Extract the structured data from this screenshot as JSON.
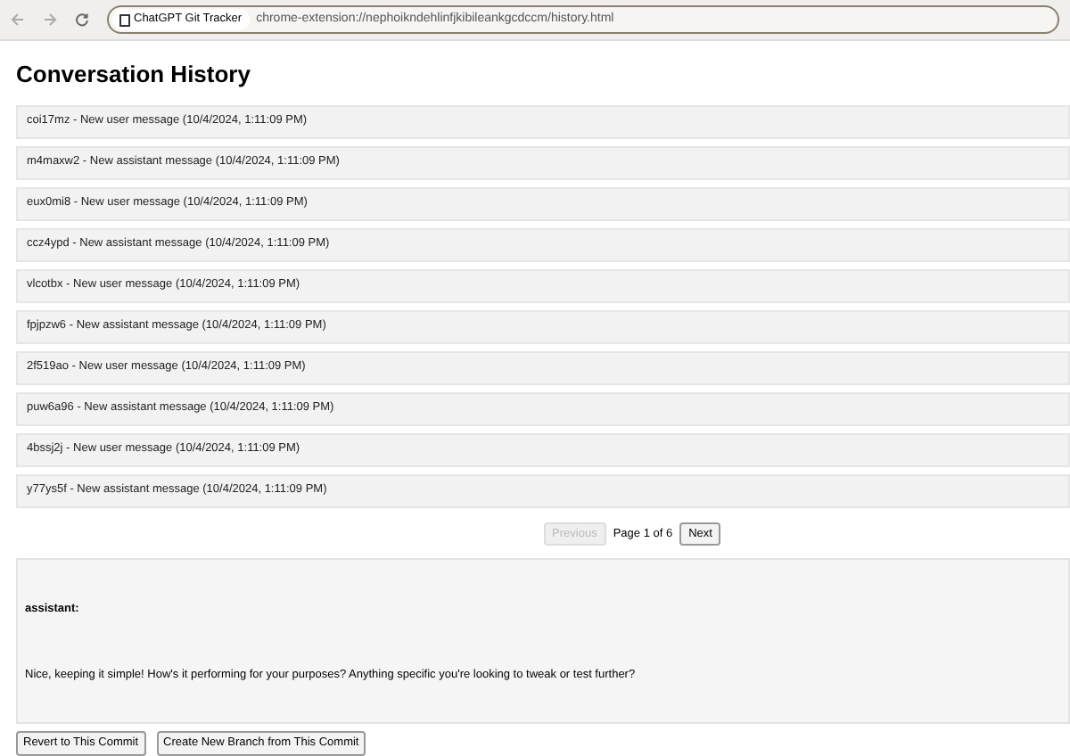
{
  "browser": {
    "tab_title": "ChatGPT Git Tracker",
    "url": "chrome-extension://nephoikndehlinfjkibileankgcdccm/history.html"
  },
  "title": "Conversation History",
  "commits": [
    {
      "label": "coi17mz - New user message (10/4/2024, 1:11:09 PM)"
    },
    {
      "label": "m4maxw2 - New assistant message (10/4/2024, 1:11:09 PM)"
    },
    {
      "label": "eux0mi8 - New user message (10/4/2024, 1:11:09 PM)"
    },
    {
      "label": "ccz4ypd - New assistant message (10/4/2024, 1:11:09 PM)"
    },
    {
      "label": "vlcotbx - New user message (10/4/2024, 1:11:09 PM)"
    },
    {
      "label": "fpjpzw6 - New assistant message (10/4/2024, 1:11:09 PM)"
    },
    {
      "label": "2f519ao - New user message (10/4/2024, 1:11:09 PM)"
    },
    {
      "label": "puw6a96 - New assistant message (10/4/2024, 1:11:09 PM)"
    },
    {
      "label": "4bssj2j - New user message (10/4/2024, 1:11:09 PM)"
    },
    {
      "label": "y77ys5f - New assistant message (10/4/2024, 1:11:09 PM)"
    }
  ],
  "pagination": {
    "previous": {
      "label": "Previous",
      "disabled": true
    },
    "page_info": "Page 1 of 6",
    "next": {
      "label": "Next",
      "disabled": false
    }
  },
  "detail": {
    "role": "assistant:",
    "content": "Nice, keeping it simple! How's it performing for your purposes? Anything specific you're looking to tweak or test further?"
  },
  "actions": [
    "Revert to This Commit",
    "Create New Branch from This Commit"
  ]
}
